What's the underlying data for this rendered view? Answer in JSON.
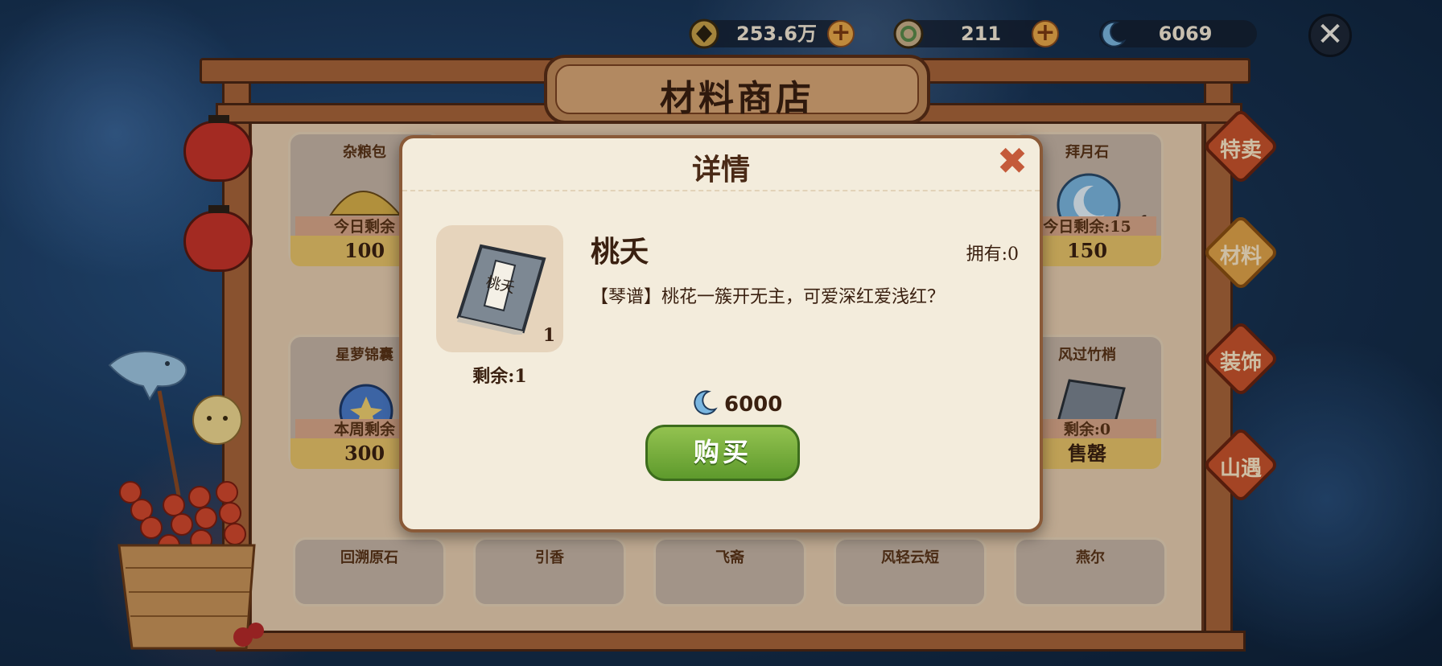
{
  "currency": {
    "coins": "253.6万",
    "tokens": "211",
    "moons": "6069"
  },
  "shop": {
    "title": "材料商店",
    "tabs": [
      "特卖",
      "材料",
      "装饰",
      "山遇"
    ],
    "active_tab": "材料",
    "cards_row1": [
      {
        "name": "杂粮包",
        "rest": "今日剩余",
        "price": "100"
      },
      {
        "name": "拜月石",
        "rest": "今日剩余:15",
        "price": "150",
        "qty": "1"
      }
    ],
    "cards_row2": [
      {
        "name": "星萝锦囊",
        "rest": "本周剩余",
        "price": "300"
      },
      {
        "name": "风过竹梢",
        "rest": "剩余:0",
        "price": "售罄"
      }
    ],
    "cards_row3": [
      {
        "name": "回溯原石"
      },
      {
        "name": "引香"
      },
      {
        "name": "飞斋"
      },
      {
        "name": "风轻云短"
      },
      {
        "name": "燕尔"
      }
    ]
  },
  "detail": {
    "header": "详情",
    "item_name": "桃夭",
    "book_label": "桃夭",
    "count": "1",
    "remaining": "剩余:1",
    "owned": "拥有:0",
    "description": "【琴谱】桃花一簇开无主，可爱深红爱浅红？",
    "price": "6000",
    "buy_label": "购买"
  },
  "colors": {
    "frame_wood": "#a8643a",
    "buy_green": "#6fa83a",
    "tab_red": "#c9542c",
    "tab_active": "#e1a44a"
  }
}
